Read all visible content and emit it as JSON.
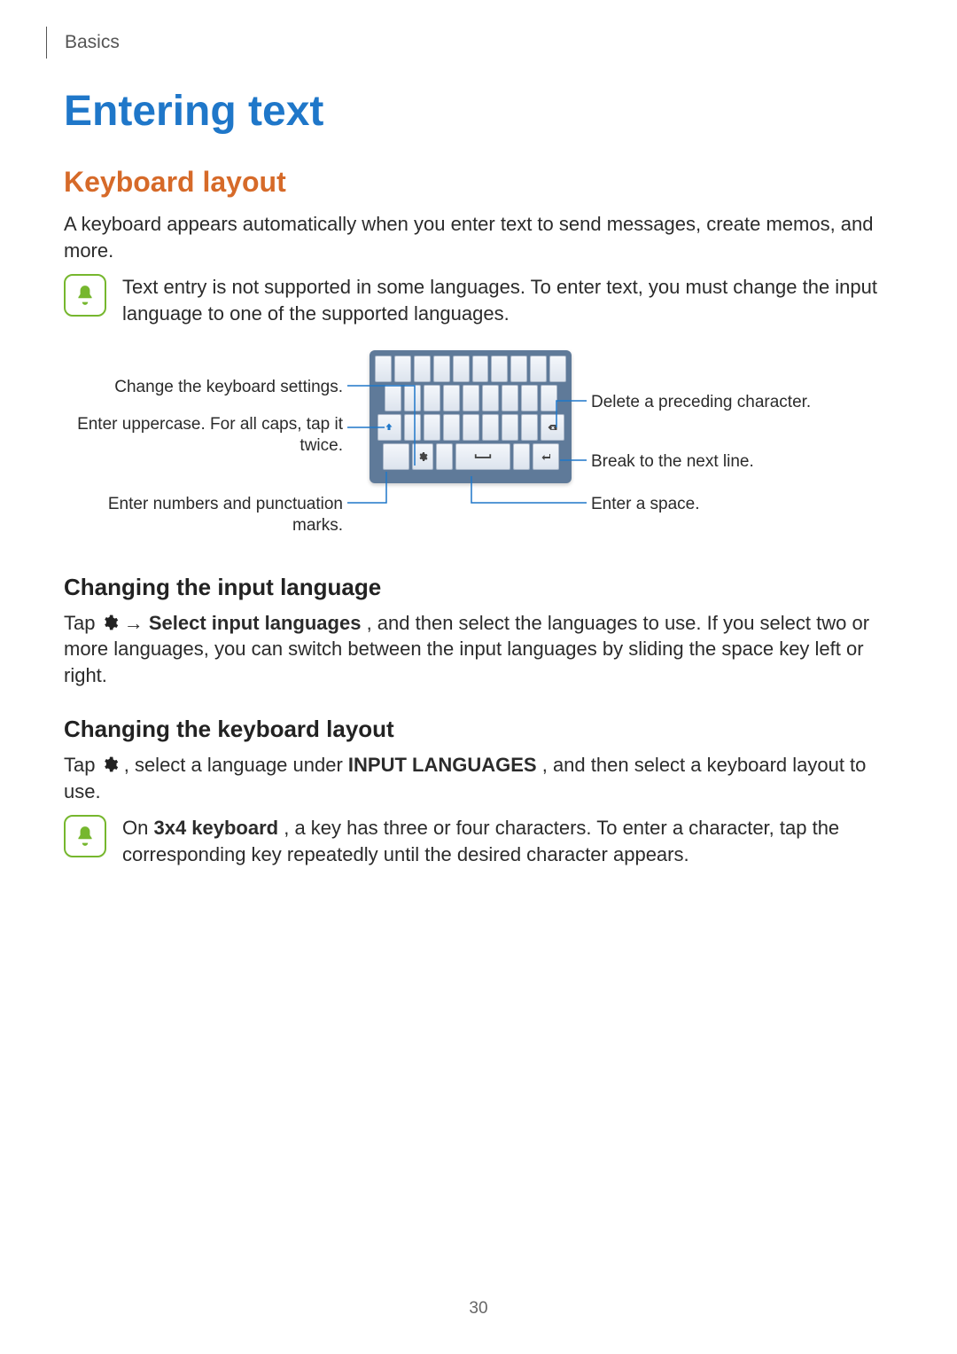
{
  "header": {
    "chapter": "Basics"
  },
  "title": "Entering text",
  "sections": {
    "keyboard_layout": {
      "heading": "Keyboard layout",
      "intro": "A keyboard appears automatically when you enter text to send messages, create memos, and more.",
      "note": "Text entry is not supported in some languages. To enter text, you must change the input language to one of the supported languages."
    },
    "diagram": {
      "left": {
        "settings": "Change the keyboard settings.",
        "uppercase": "Enter uppercase. For all caps, tap it twice.",
        "numbers": "Enter numbers and punctuation marks."
      },
      "right": {
        "delete": "Delete a preceding character.",
        "nextline": "Break to the next line.",
        "space": "Enter a space."
      }
    },
    "changing_input_language": {
      "heading": "Changing the input language",
      "p_pre": "Tap ",
      "p_arrow": " → ",
      "p_bold": "Select input languages",
      "p_post": ", and then select the languages to use. If you select two or more languages, you can switch between the input languages by sliding the space key left or right."
    },
    "changing_keyboard_layout": {
      "heading": "Changing the keyboard layout",
      "p_pre": "Tap ",
      "p_mid1": ", select a language under ",
      "p_bold": "INPUT LANGUAGES",
      "p_post": ", and then select a keyboard layout to use.",
      "note_pre": "On ",
      "note_bold": "3x4 keyboard",
      "note_post": ", a key has three or four characters. To enter a character, tap the corresponding key repeatedly until the desired character appears."
    }
  },
  "page_number": "30"
}
